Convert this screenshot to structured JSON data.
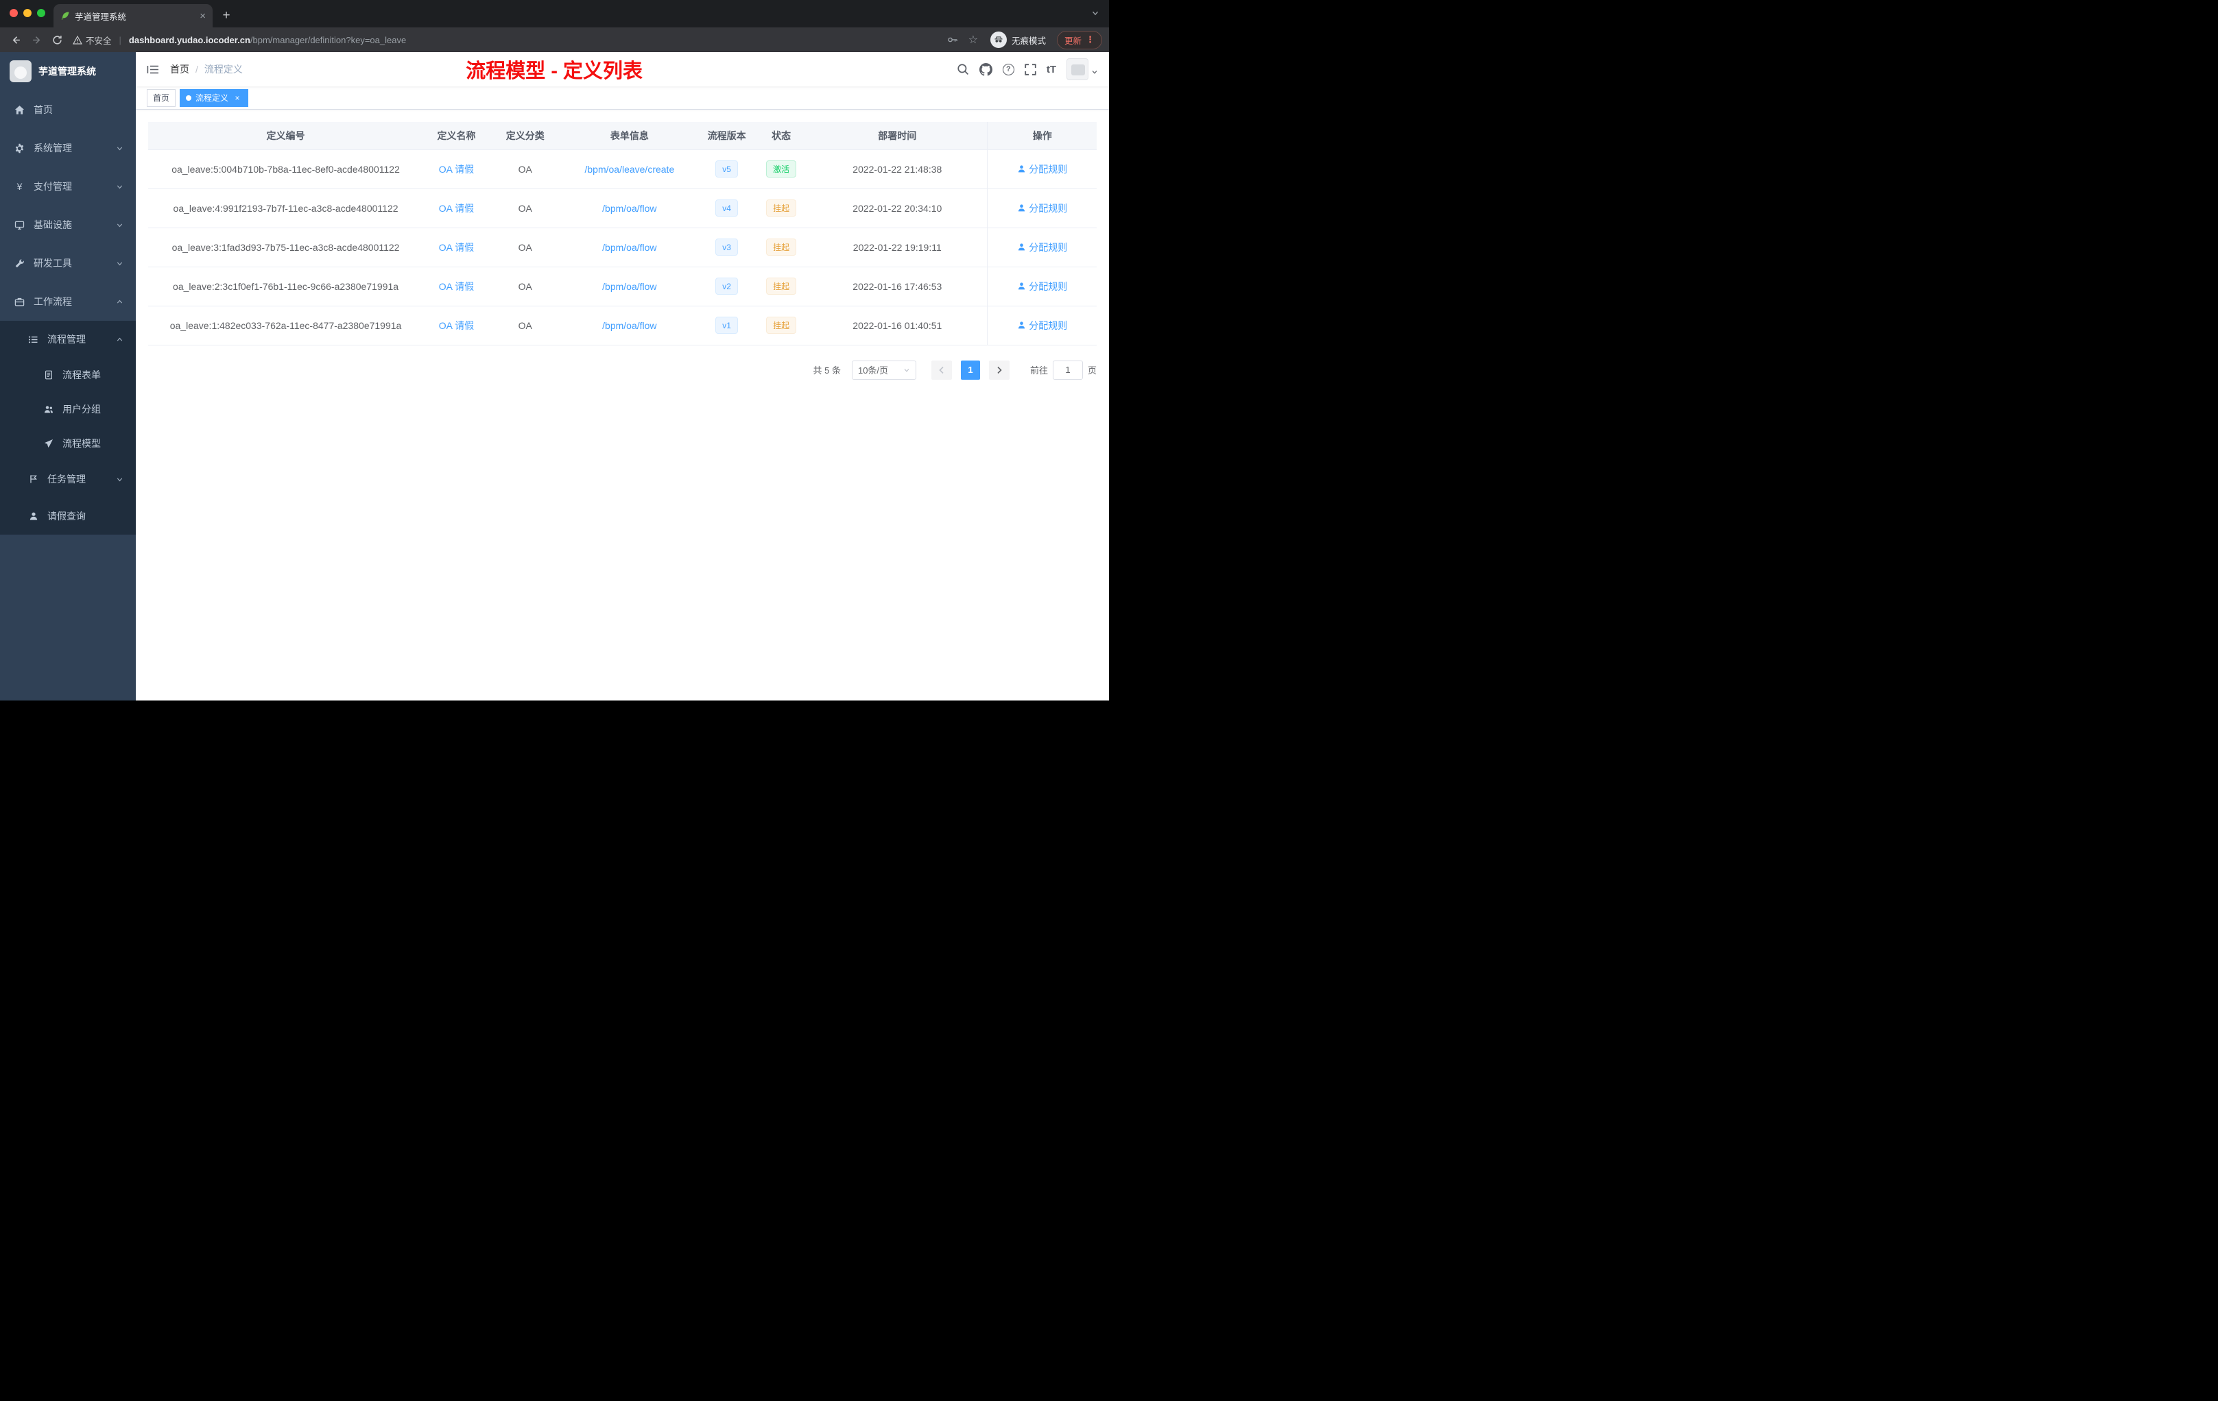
{
  "colors": {
    "accent": "#409eff",
    "success": "#13ce66",
    "warning": "#e6a23c",
    "annotation_red": "#f40f0f",
    "sidebar_bg": "#304156",
    "submenu_bg": "#1f2d3d"
  },
  "browser": {
    "tab_title": "芋道管理系统",
    "security_label": "不安全",
    "url_host": "dashboard.yudao.iocoder.cn",
    "url_path": "/bpm/manager/definition?key=oa_leave",
    "incognito_label": "无痕模式",
    "update_label": "更新"
  },
  "sidebar": {
    "logo_title": "芋道管理系统",
    "items": [
      {
        "label": "首页"
      },
      {
        "label": "系统管理"
      },
      {
        "label": "支付管理"
      },
      {
        "label": "基础设施"
      },
      {
        "label": "研发工具"
      },
      {
        "label": "工作流程"
      },
      {
        "label": "流程管理"
      },
      {
        "label": "流程表单"
      },
      {
        "label": "用户分组"
      },
      {
        "label": "流程模型"
      },
      {
        "label": "任务管理"
      },
      {
        "label": "请假查询"
      }
    ]
  },
  "header": {
    "breadcrumb": [
      "首页",
      "流程定义"
    ],
    "annotation": "流程模型 - 定义列表",
    "size_icon_label": "tT"
  },
  "tags": [
    {
      "label": "首页"
    },
    {
      "label": "流程定义"
    }
  ],
  "table": {
    "headers": [
      "定义编号",
      "定义名称",
      "定义分类",
      "表单信息",
      "流程版本",
      "状态",
      "部署时间",
      "操作"
    ],
    "action_label": "分配规则",
    "rows": [
      {
        "id": "oa_leave:5:004b710b-7b8a-11ec-8ef0-acde48001122",
        "name": "OA 请假",
        "category": "OA",
        "form": "/bpm/oa/leave/create",
        "version": "v5",
        "status": "激活",
        "time": "2022-01-22 21:48:38"
      },
      {
        "id": "oa_leave:4:991f2193-7b7f-11ec-a3c8-acde48001122",
        "name": "OA 请假",
        "category": "OA",
        "form": "/bpm/oa/flow",
        "version": "v4",
        "status": "挂起",
        "time": "2022-01-22 20:34:10"
      },
      {
        "id": "oa_leave:3:1fad3d93-7b75-11ec-a3c8-acde48001122",
        "name": "OA 请假",
        "category": "OA",
        "form": "/bpm/oa/flow",
        "version": "v3",
        "status": "挂起",
        "time": "2022-01-22 19:19:11"
      },
      {
        "id": "oa_leave:2:3c1f0ef1-76b1-11ec-9c66-a2380e71991a",
        "name": "OA 请假",
        "category": "OA",
        "form": "/bpm/oa/flow",
        "version": "v2",
        "status": "挂起",
        "time": "2022-01-16 17:46:53"
      },
      {
        "id": "oa_leave:1:482ec033-762a-11ec-8477-a2380e71991a",
        "name": "OA 请假",
        "category": "OA",
        "form": "/bpm/oa/flow",
        "version": "v1",
        "status": "挂起",
        "time": "2022-01-16 01:40:51"
      }
    ]
  },
  "pagination": {
    "total": "共 5 条",
    "page_size": "10条/页",
    "current_page": "1",
    "goto_label": "前往",
    "goto_value": "1",
    "unit_label": "页"
  }
}
